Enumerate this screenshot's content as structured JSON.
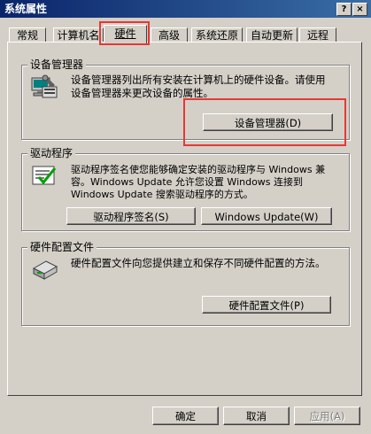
{
  "window": {
    "title": "系统属性",
    "help_glyph": "?",
    "close_glyph": "×"
  },
  "tabs": [
    {
      "label": "常规"
    },
    {
      "label": "计算机名"
    },
    {
      "label": "硬件"
    },
    {
      "label": "高级"
    },
    {
      "label": "系统还原"
    },
    {
      "label": "自动更新"
    },
    {
      "label": "远程"
    }
  ],
  "device_manager": {
    "heading": "设备管理器",
    "description": "设备管理器列出所有安装在计算机上的硬件设备。请使用设备管理器来更改设备的属性。",
    "button": "设备管理器(D)"
  },
  "drivers": {
    "heading": "驱动程序",
    "description": "驱动程序签名使您能够确定安装的驱动程序与 Windows 兼容。Windows Update 允许您设置 Windows 连接到 Windows Update 搜索驱动程序的方式。",
    "signing_button": "驱动程序签名(S)",
    "update_button": "Windows Update(W)"
  },
  "hardware_profiles": {
    "heading": "硬件配置文件",
    "description": "硬件配置文件向您提供建立和保存不同硬件配置的方法。",
    "button": "硬件配置文件(P)"
  },
  "footer": {
    "ok": "确定",
    "cancel": "取消",
    "apply": "应用(A)"
  },
  "highlight_color": "#e53935"
}
